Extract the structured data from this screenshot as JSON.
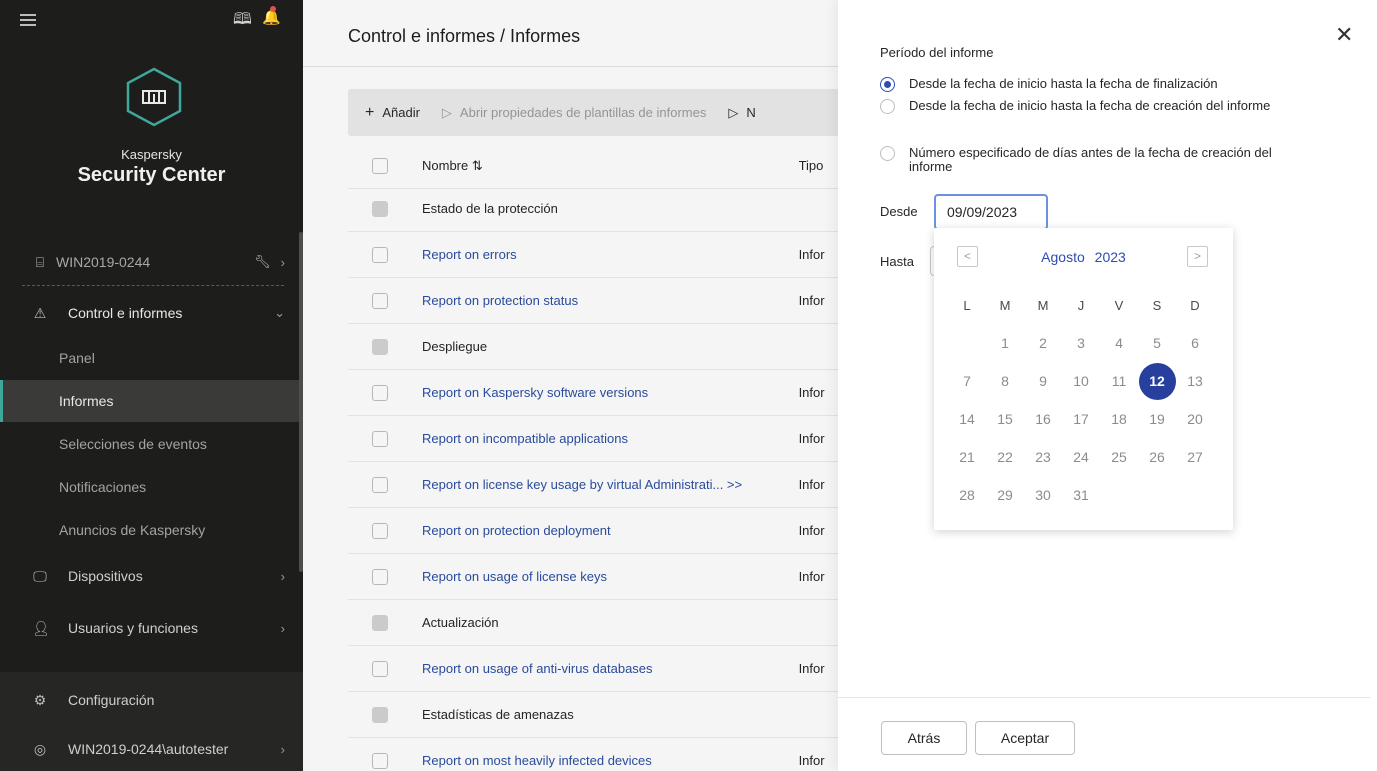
{
  "sidebar": {
    "brand_line1": "Kaspersky",
    "brand_line2": "Security Center",
    "icons": {
      "menu": "hamburger-icon",
      "book": "book-icon",
      "bell": "bell-icon",
      "logo": "kaspersky-logo"
    },
    "host": "WIN2019-0244",
    "section_monitoring": "Control e informes",
    "sub_items": [
      "Panel",
      "Informes",
      "Selecciones de eventos",
      "Notificaciones",
      "Anuncios de Kaspersky"
    ],
    "devices": "Dispositivos",
    "users_roles": "Usuarios y funciones",
    "settings": "Configuración",
    "user": "WIN2019-0244\\autotester"
  },
  "main": {
    "breadcrumb": "Control e informes  /  Informes",
    "toolbar": {
      "add": "Añadir",
      "open_props": "Abrir propiedades de plantillas de informes",
      "next": "N"
    },
    "columns": {
      "name": "Nombre ⇅",
      "type": "Tipo"
    },
    "rows": [
      {
        "name": "Estado de la protección",
        "type": "",
        "group": true
      },
      {
        "name": "Report on errors",
        "type": "Infor",
        "group": false
      },
      {
        "name": "Report on protection status",
        "type": "Infor",
        "group": false
      },
      {
        "name": "Despliegue",
        "type": "",
        "group": true
      },
      {
        "name": "Report on Kaspersky software versions",
        "type": "Infor",
        "group": false
      },
      {
        "name": "Report on incompatible applications",
        "type": "Infor",
        "group": false
      },
      {
        "name": "Report on license key usage by virtual Administrati...  >>",
        "type": "Infor",
        "group": false
      },
      {
        "name": "Report on protection deployment",
        "type": "Infor",
        "group": false
      },
      {
        "name": "Report on usage of license keys",
        "type": "Infor",
        "group": false
      },
      {
        "name": "Actualización",
        "type": "",
        "group": true
      },
      {
        "name": "Report on usage of anti-virus databases",
        "type": "Infor",
        "group": false
      },
      {
        "name": "Estadísticas de amenazas",
        "type": "",
        "group": true
      },
      {
        "name": "Report on most heavily infected devices",
        "type": "Infor",
        "group": false
      }
    ]
  },
  "panel": {
    "period_label": "Período del informe",
    "options": [
      {
        "text": "Desde la fecha de inicio hasta la fecha de finalización",
        "checked": true
      },
      {
        "text": "Desde la fecha de inicio hasta la fecha de creación del informe",
        "checked": false
      },
      {
        "text": "Número especificado de días antes de la fecha de creación del informe",
        "checked": false
      }
    ],
    "from_label": "Desde",
    "from_value": "09/09/2023",
    "to_label": "Hasta",
    "calendar": {
      "month": "Agosto",
      "year": "2023",
      "weekdays": [
        "L",
        "M",
        "M",
        "J",
        "V",
        "S",
        "D"
      ],
      "weeks": [
        [
          "",
          "1",
          "2",
          "3",
          "4",
          "5",
          "6"
        ],
        [
          "7",
          "8",
          "9",
          "10",
          "11",
          "12",
          "13"
        ],
        [
          "14",
          "15",
          "16",
          "17",
          "18",
          "19",
          "20"
        ],
        [
          "21",
          "22",
          "23",
          "24",
          "25",
          "26",
          "27"
        ],
        [
          "28",
          "29",
          "30",
          "31",
          "",
          "",
          ""
        ]
      ],
      "selected": "12",
      "accent": "#27409e"
    },
    "back": "Atrás",
    "accept": "Aceptar",
    "close": "✕"
  }
}
